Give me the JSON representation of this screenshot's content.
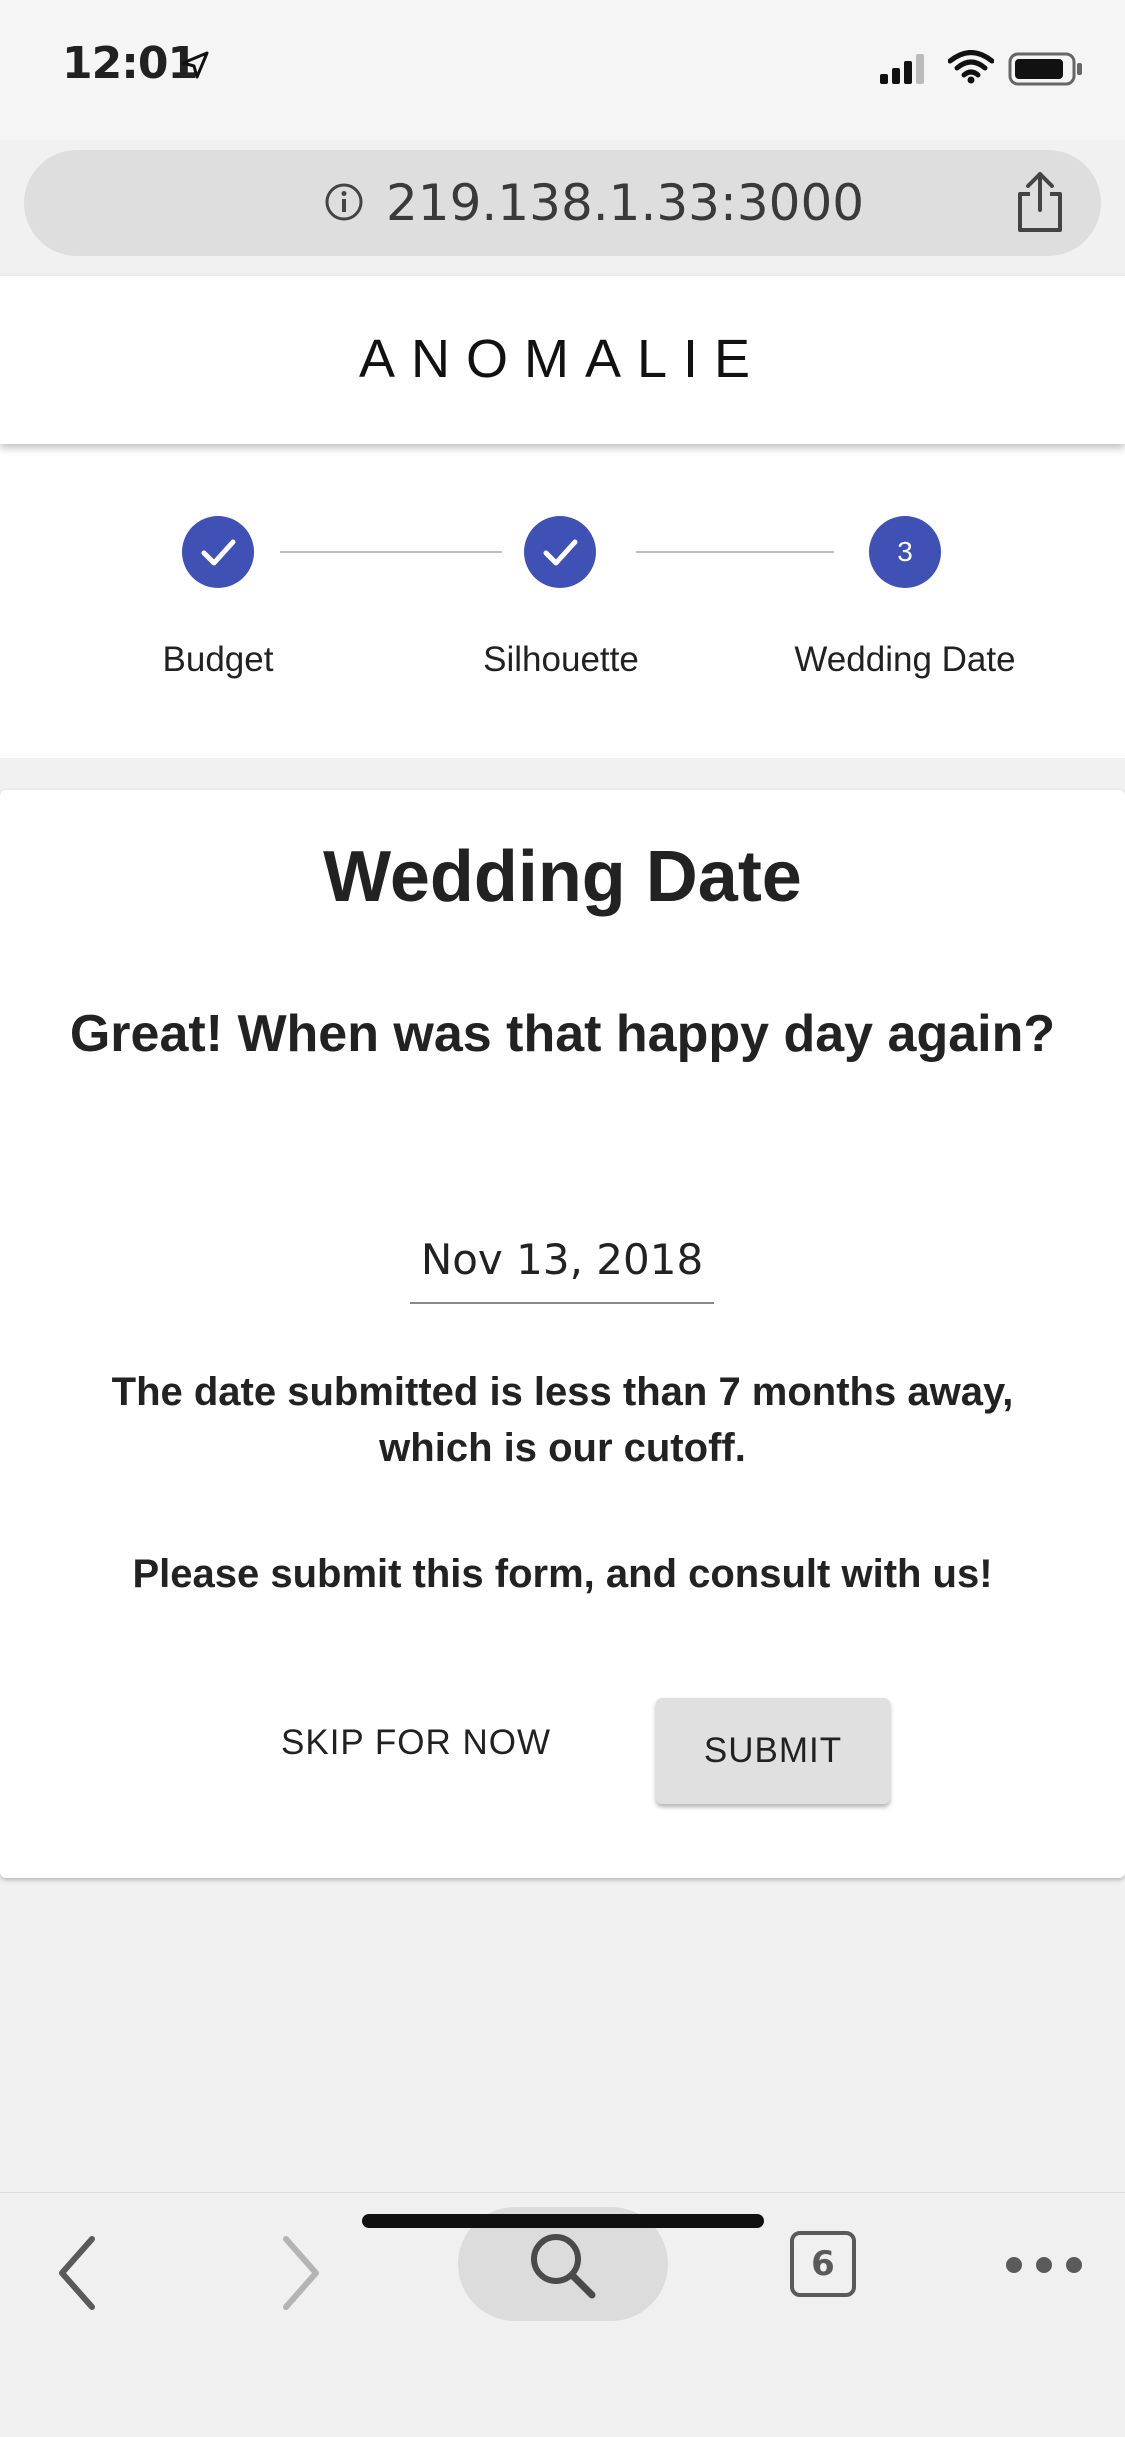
{
  "status_bar": {
    "time": "12:01"
  },
  "browser": {
    "url": "219.138.1.33:3000",
    "tab_count": "6"
  },
  "header": {
    "brand": "ANOMALIE"
  },
  "stepper": {
    "steps": [
      {
        "label": "Budget",
        "state": "completed"
      },
      {
        "label": "Silhouette",
        "state": "completed"
      },
      {
        "label": "Wedding Date",
        "state": "active",
        "number": "3"
      }
    ],
    "accent_color": "#3f51b5"
  },
  "card": {
    "title": "Wedding Date",
    "question": "Great! When was that happy day again?",
    "date_value": "Nov 13, 2018",
    "warning": "The date submitted is less than 7 months away, which is our cutoff.",
    "consult": "Please submit this form, and consult with us!",
    "skip_label": "SKIP FOR NOW",
    "submit_label": "SUBMIT"
  },
  "toolbar": {
    "icons": [
      "back-icon",
      "forward-icon",
      "search-icon",
      "tabs-icon",
      "more-icon"
    ]
  }
}
